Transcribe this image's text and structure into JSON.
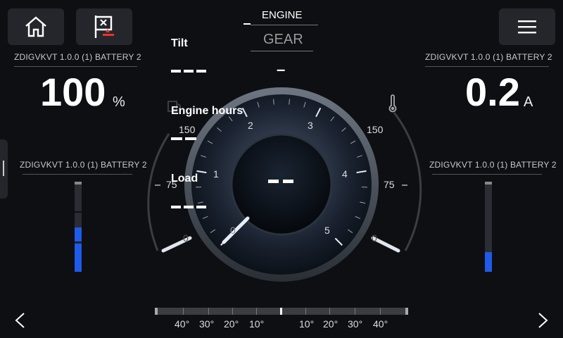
{
  "header": {
    "engine_label": "ENGINE",
    "gear_label": "GEAR",
    "gear_value": "–",
    "engine_value": "–"
  },
  "left": {
    "source_top": "ZDIGVKVT 1.0.0 (1) BATTERY 2",
    "value": "100",
    "unit": "%",
    "source_bottom": "ZDIGVKVT 1.0.0 (1) BATTERY 2",
    "bar_level": 0.55
  },
  "right": {
    "source_top": "ZDIGVKVT 1.0.0 (1) BATTERY 2",
    "value": "0.2",
    "unit": "A",
    "source_bottom": "ZDIGVKVT 1.0.0 (1) BATTERY 2",
    "bar_level": 0.22
  },
  "readouts": {
    "tilt_label": "Tilt",
    "engine_hours_label": "Engine hours",
    "load_label": "Load",
    "center_value": "– –"
  },
  "gauge": {
    "rpm_ticks": [
      "0",
      "1",
      "2",
      "3",
      "4",
      "5"
    ],
    "left_scale": [
      "150",
      "75",
      "0"
    ],
    "right_scale": [
      "150",
      "75",
      "0"
    ]
  },
  "trim": {
    "left_ticks": [
      "40°",
      "30°",
      "20°",
      "10°"
    ],
    "right_ticks": [
      "10°",
      "20°",
      "30°",
      "40°"
    ]
  },
  "icons": {
    "home": "home-icon",
    "flag": "flag-alert-icon",
    "menu": "menu-icon",
    "thermo": "thermometer-icon",
    "fuel": "fuel-icon",
    "prev": "chevron-left-icon",
    "next": "chevron-right-icon"
  },
  "colors": {
    "accent": "#1e5be8",
    "panel": "#24262b"
  }
}
